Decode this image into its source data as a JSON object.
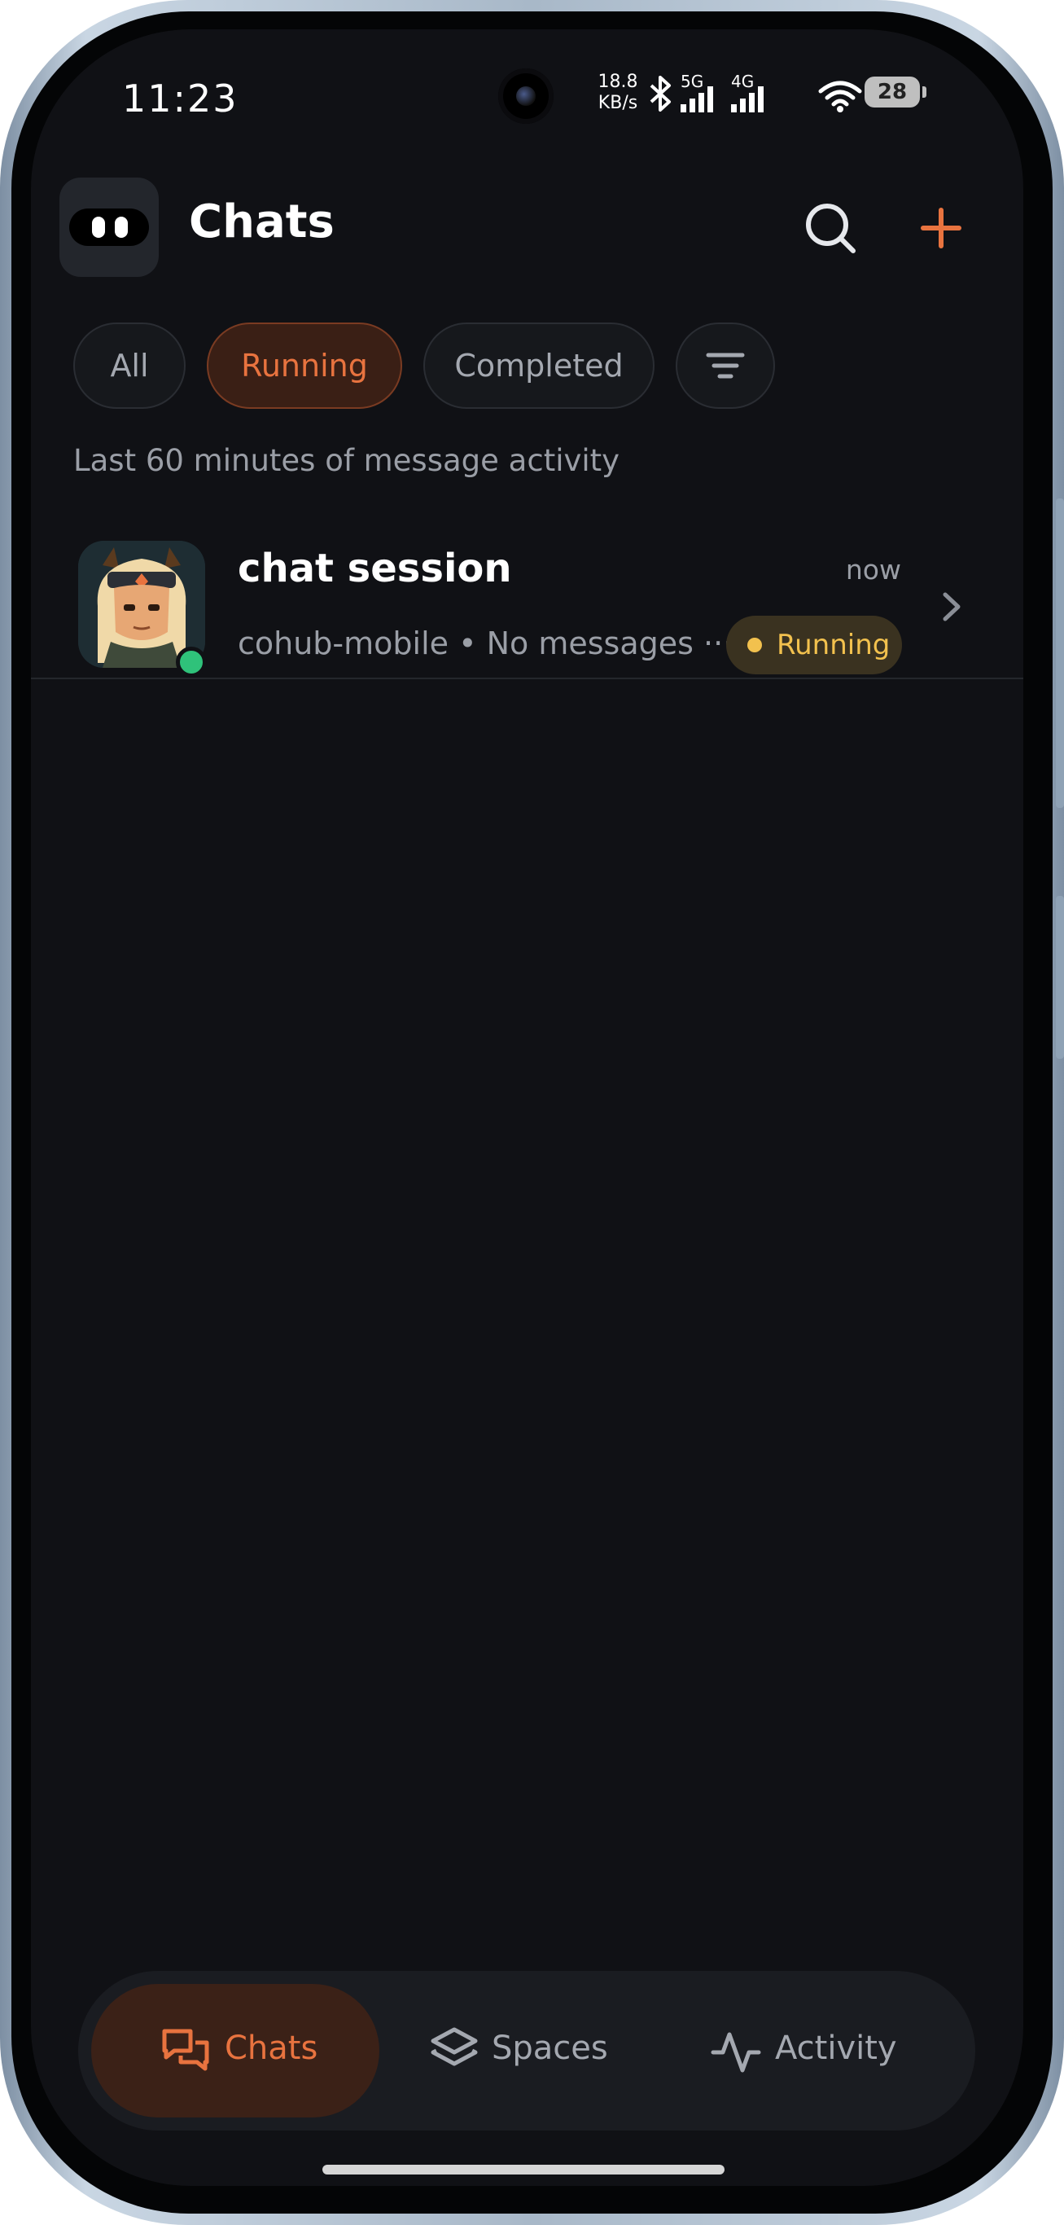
{
  "status_bar": {
    "time": "11:23",
    "net_speed_value": "18.8",
    "net_speed_unit": "KB/s",
    "net_label_1": "5G",
    "net_label_2": "4G",
    "battery": "28"
  },
  "header": {
    "title": "Chats",
    "search_icon": "search-icon",
    "add_icon": "plus-icon",
    "accent": "#e8733f"
  },
  "filters": {
    "chips": [
      {
        "label": "All",
        "active": false
      },
      {
        "label": "Running",
        "active": true
      },
      {
        "label": "Completed",
        "active": false
      }
    ],
    "filter_icon": "filter-lines-icon"
  },
  "subtitle": "Last 60 minutes of message activity",
  "chats": [
    {
      "title": "chat session",
      "time": "now",
      "subtitle": "cohub-mobile • No messages ···",
      "status": "Running",
      "status_color": "#f2c14e",
      "online": true
    }
  ],
  "nav": {
    "items": [
      {
        "label": "Chats",
        "icon": "chat-bubbles-icon",
        "active": true
      },
      {
        "label": "Spaces",
        "icon": "layers-icon",
        "active": false
      },
      {
        "label": "Activity",
        "icon": "pulse-icon",
        "active": false
      }
    ]
  }
}
